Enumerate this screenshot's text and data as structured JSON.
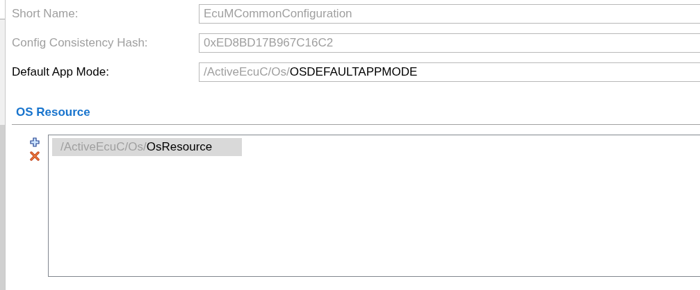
{
  "fields": [
    {
      "label": "Short Name:",
      "disabled": true,
      "value": "EcuMCommonConfiguration"
    },
    {
      "label": "Config Consistency Hash:",
      "disabled": true,
      "value": "0xED8BD17B967C16C2"
    },
    {
      "label": "Default App Mode:",
      "disabled": false,
      "path": "/ActiveEcuC/Os/",
      "value": "OSDEFAULTAPPMODE"
    }
  ],
  "section": {
    "title": "OS Resource",
    "items": [
      {
        "path": "/ActiveEcuC/Os/",
        "name": "OsResource",
        "selected": true
      }
    ]
  }
}
